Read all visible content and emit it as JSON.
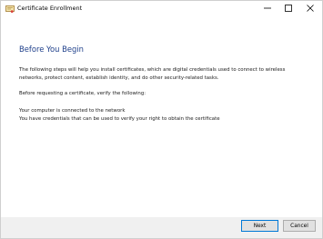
{
  "window": {
    "title": "Certificate Enrollment",
    "icon": "certificate-icon",
    "controls": {
      "minimize_glyph": "minimize-icon",
      "maximize_glyph": "maximize-icon",
      "close_glyph": "close-icon"
    }
  },
  "page": {
    "heading": "Before You Begin",
    "paragraph1": [
      "The following steps will help you install certificates, which are digital credentials used to connect to wireless",
      "networks, protect content, establish identity, and do other security-related tasks."
    ],
    "paragraph2": "Before requesting a certificate, verify the following:",
    "requirements": [
      "Your computer is connected to the network",
      "You have credentials that can be used to verify your right to obtain the certificate"
    ]
  },
  "buttons": {
    "next": "Next",
    "cancel": "Cancel"
  },
  "colors": {
    "heading": "#1e3f8a",
    "footer": "#f0f0f0",
    "default_button_border": "#0078d7"
  }
}
